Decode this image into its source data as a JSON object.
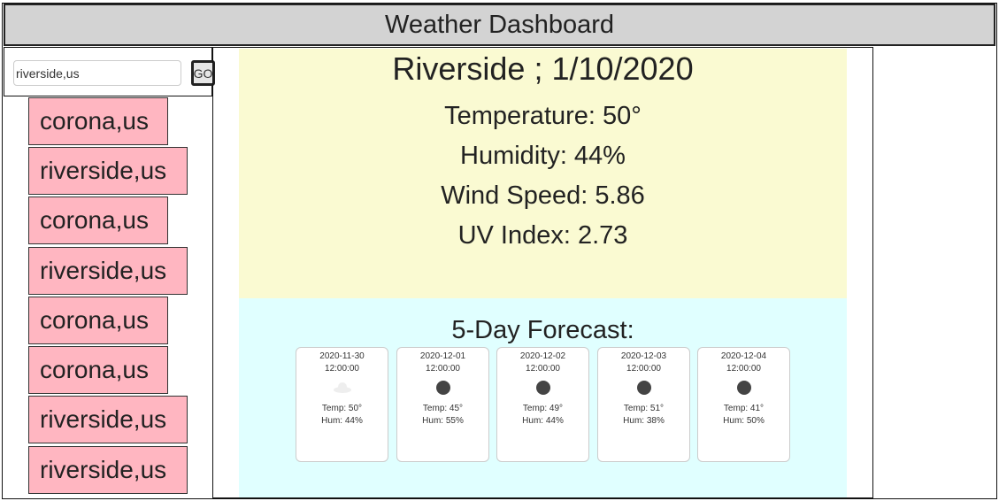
{
  "app": {
    "title": "Weather Dashboard"
  },
  "search": {
    "value": "riverside,us",
    "go_label": "GO"
  },
  "history": [
    "corona,us",
    "riverside,us",
    "corona,us",
    "riverside,us",
    "corona,us",
    "corona,us",
    "riverside,us",
    "riverside,us"
  ],
  "current": {
    "heading": "Riverside ; 1/10/2020",
    "temperature": "Temperature: 50°",
    "humidity": "Humidity: 44%",
    "wind": "Wind Speed: 5.86",
    "uv": "UV Index: 2.73"
  },
  "forecast": {
    "title": "5-Day Forecast:",
    "days": [
      {
        "date": "2020-11-30",
        "time": "12:00:00",
        "icon": "cloud-icon",
        "temp": "Temp: 50°",
        "hum": "Hum: 44%"
      },
      {
        "date": "2020-12-01",
        "time": "12:00:00",
        "icon": "moon-icon",
        "temp": "Temp: 45°",
        "hum": "Hum: 55%"
      },
      {
        "date": "2020-12-02",
        "time": "12:00:00",
        "icon": "moon-icon",
        "temp": "Temp: 49°",
        "hum": "Hum: 44%"
      },
      {
        "date": "2020-12-03",
        "time": "12:00:00",
        "icon": "moon-icon",
        "temp": "Temp: 51°",
        "hum": "Hum: 38%"
      },
      {
        "date": "2020-12-04",
        "time": "12:00:00",
        "icon": "moon-icon",
        "temp": "Temp: 41°",
        "hum": "Hum: 50%"
      }
    ]
  },
  "colors": {
    "header_bg": "#d3d3d3",
    "history_bg": "#ffb6c1",
    "current_bg": "#fafad2",
    "forecast_bg": "#e0ffff"
  }
}
